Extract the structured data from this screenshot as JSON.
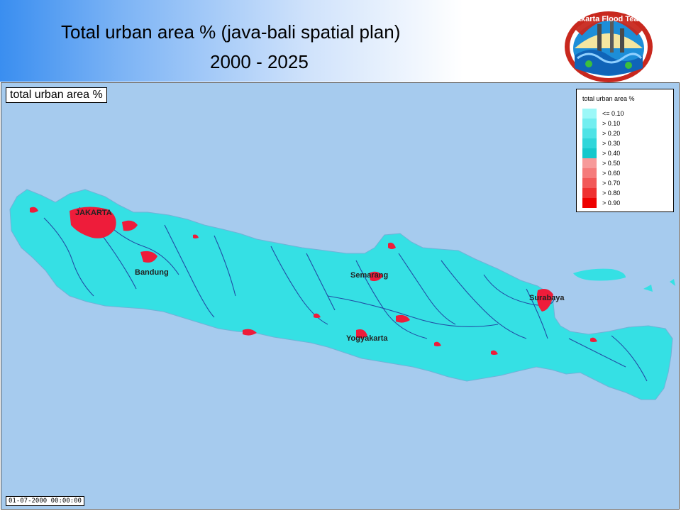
{
  "header": {
    "title_line1": "Total urban area % (java-bali spatial plan)",
    "title_line2": "2000 - 2025",
    "logo_text": "Jakarta Flood Team"
  },
  "map": {
    "label": "total urban area   %",
    "timestamp": "01-07-2000 00:00:00",
    "colors": {
      "sea": "#a6cbee",
      "land": "#35e0e4",
      "river": "#1f3c9e",
      "urban": "#ee1c3a"
    },
    "cities": [
      {
        "name": "JAKARTA"
      },
      {
        "name": "Bandung"
      },
      {
        "name": "Semarang"
      },
      {
        "name": "Yogyakarta"
      },
      {
        "name": "Surabaya"
      }
    ]
  },
  "legend": {
    "title": "total urban area   %",
    "items": [
      {
        "label": "<= 0.10",
        "color": "#9cf8f8"
      },
      {
        "label": "> 0.10",
        "color": "#72eef0"
      },
      {
        "label": "> 0.20",
        "color": "#4ee3e6"
      },
      {
        "label": "> 0.30",
        "color": "#2fd6da"
      },
      {
        "label": "> 0.40",
        "color": "#15c8cc"
      },
      {
        "label": "> 0.50",
        "color": "#f79a9a"
      },
      {
        "label": "> 0.60",
        "color": "#f57b7b"
      },
      {
        "label": "> 0.70",
        "color": "#f25858"
      },
      {
        "label": "> 0.80",
        "color": "#ef3030"
      },
      {
        "label": "> 0.90",
        "color": "#ee0000"
      }
    ]
  }
}
